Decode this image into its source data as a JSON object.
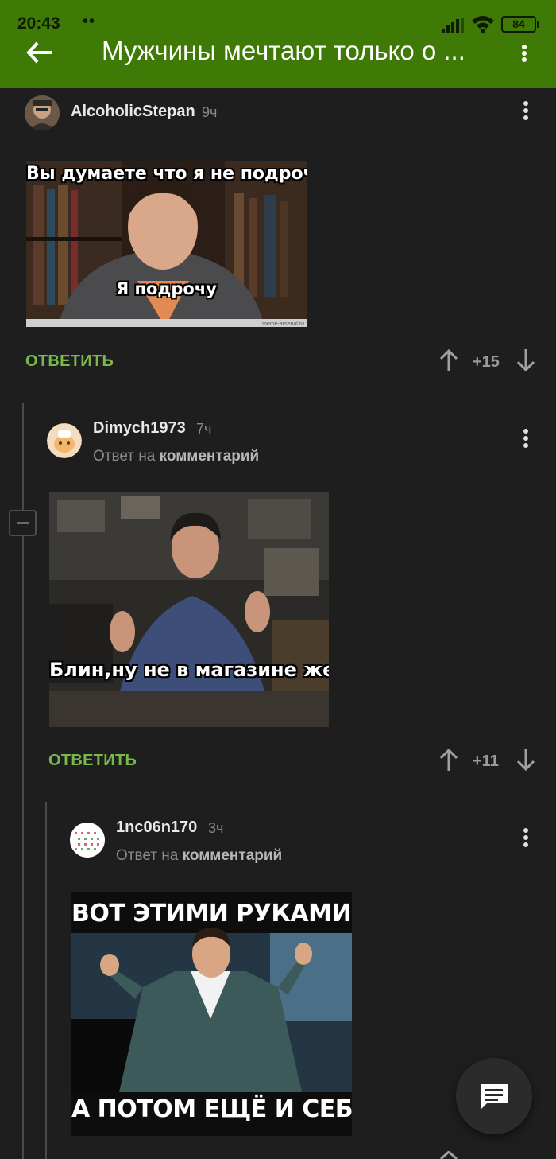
{
  "status": {
    "time": "20:43",
    "extra": "••",
    "battery": "84"
  },
  "header": {
    "title": "Мужчины мечтают только о ..."
  },
  "comments": [
    {
      "user": "AlcoholicStepan",
      "time": "9ч",
      "image": {
        "caption_top": "Вы думаете что я не подрочу?",
        "caption_bottom": "Я подрочу",
        "watermark": "meme-arsenal.ru"
      },
      "reply_label": "ОТВЕТИТЬ",
      "score": "+15"
    },
    {
      "user": "Dimych1973",
      "time": "7ч",
      "reply_prefix": "Ответ на",
      "reply_target": "комментарий",
      "image": {
        "caption_bottom": "Блин,ну не в магазине же"
      },
      "reply_label": "ОТВЕТИТЬ",
      "score": "+11"
    },
    {
      "user": "1nc06n170",
      "time": "3ч",
      "reply_prefix": "Ответ на",
      "reply_target": "комментарий",
      "image": {
        "caption_top": "ВОТ ЭТИМИ РУКАМИ!",
        "caption_bottom": "А ПОТОМ ЕЩЁ И СЕБЕ!"
      }
    }
  ],
  "icons": {
    "back": "arrow-left-icon",
    "menu": "kebab-icon",
    "upvote": "arrow-up-icon",
    "downvote": "arrow-down-icon",
    "fab": "comment-icon"
  },
  "colors": {
    "appbar": "#3f7a06",
    "background": "#1e1e1e",
    "reply": "#79b94a"
  }
}
